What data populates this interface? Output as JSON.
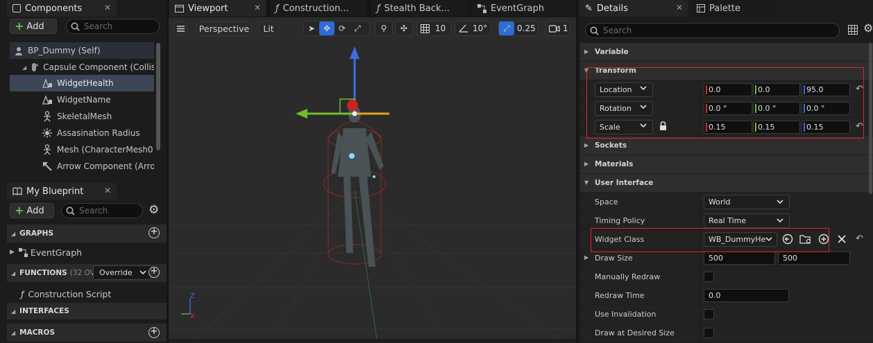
{
  "components_panel": {
    "tab_title": "Components",
    "add_label": "Add",
    "search_placeholder": "Search",
    "tree": [
      {
        "label": "BP_Dummy (Self)",
        "icon": "actor-icon"
      },
      {
        "label": "Capsule Component (Collisi",
        "icon": "capsule-icon"
      },
      {
        "label": "WidgetHealth",
        "icon": "widget-icon",
        "selected": true
      },
      {
        "label": "WidgetName",
        "icon": "widget-icon"
      },
      {
        "label": "SkeletalMesh",
        "icon": "skeleton-icon"
      },
      {
        "label": "Assasination Radius",
        "icon": "sphere-icon"
      },
      {
        "label": "Mesh (CharacterMesh0)",
        "icon": "skeleton-icon"
      },
      {
        "label": "Arrow Component (Arrow",
        "icon": "arrow-icon"
      }
    ]
  },
  "my_blueprint": {
    "tab_title": "My Blueprint",
    "add_label": "Add",
    "search_placeholder": "Search",
    "sections": {
      "graphs": "GRAPHS",
      "event_graph": "EventGraph",
      "functions": "FUNCTIONS",
      "functions_count": "(32 OV",
      "override": "Override",
      "construction_script": "Construction Script",
      "interfaces": "INTERFACES",
      "macros": "MACROS"
    }
  },
  "editor_tabs": [
    "Viewport",
    "Construction...",
    "Stealth Back...",
    "EventGraph"
  ],
  "viewport": {
    "perspective": "Perspective",
    "lit": "Lit",
    "grid_size": "10",
    "rotation_snap": "10°",
    "scale_snap": "0.25",
    "camera_speed": "1",
    "axis_x": "X",
    "axis_z": "Z"
  },
  "details": {
    "tab_title": "Details",
    "palette_tab": "Palette",
    "search_placeholder": "Search",
    "categories": {
      "variable": "Variable",
      "transform": "Transform",
      "sockets": "Sockets",
      "materials": "Materials",
      "user_interface": "User Interface"
    },
    "transform": {
      "location": {
        "label": "Location",
        "x": "0.0",
        "y": "0.0",
        "z": "95.0"
      },
      "rotation": {
        "label": "Rotation",
        "x": "0.0 °",
        "y": "0.0 °",
        "z": "0.0 °"
      },
      "scale": {
        "label": "Scale",
        "x": "0.15",
        "y": "0.15",
        "z": "0.15"
      }
    },
    "ui": {
      "space_label": "Space",
      "space_value": "World",
      "timing_label": "Timing Policy",
      "timing_value": "Real Time",
      "widget_class_label": "Widget Class",
      "widget_class_value": "WB_DummyHe",
      "draw_size_label": "Draw Size",
      "draw_size_x": "500",
      "draw_size_y": "500",
      "manual_redraw_label": "Manually Redraw",
      "redraw_time_label": "Redraw Time",
      "redraw_time_value": "0.0",
      "use_invalidation_label": "Use Invalidation",
      "draw_desired_label": "Draw at Desired Size"
    }
  },
  "colors": {
    "accent_blue": "#2c6cd6",
    "highlight_red": "#e0242c",
    "axis_x": "#d23030",
    "axis_y": "#6fbf2e",
    "axis_z": "#3b6fe0"
  }
}
